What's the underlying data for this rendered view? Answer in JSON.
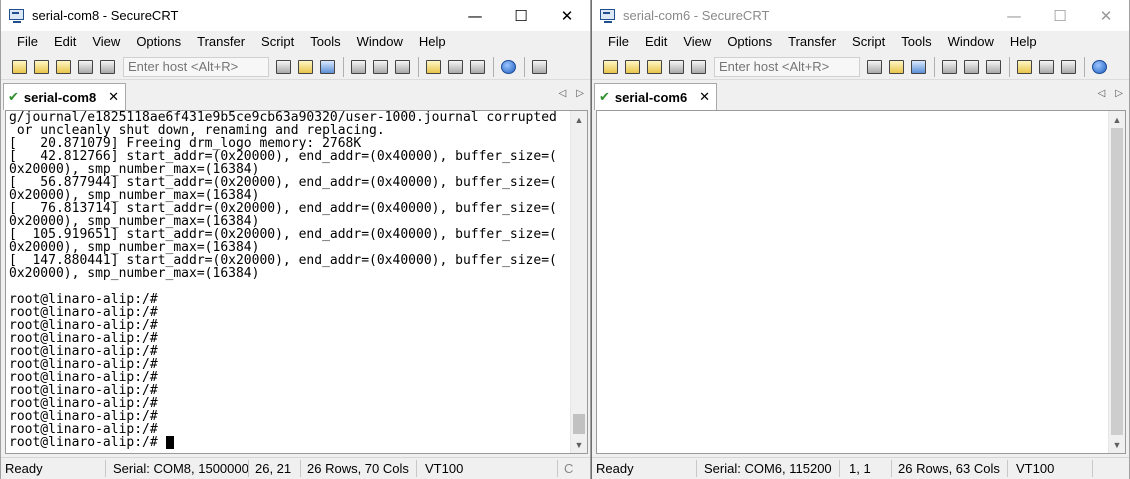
{
  "menu": [
    "File",
    "Edit",
    "View",
    "Options",
    "Transfer",
    "Script",
    "Tools",
    "Window",
    "Help"
  ],
  "host_placeholder": "Enter host <Alt+R>",
  "left": {
    "title": "serial-com8 - SecureCRT",
    "tab": "serial-com8",
    "terminal_lines": [
      "g/journal/e1825118ae6f431e9b5ce9cb63a90320/user-1000.journal corrupted",
      " or uncleanly shut down, renaming and replacing.",
      "[   20.871079] Freeing drm_logo memory: 2768K",
      "[   42.812766] start_addr=(0x20000), end_addr=(0x40000), buffer_size=(",
      "0x20000), smp_number_max=(16384)",
      "[   56.877944] start_addr=(0x20000), end_addr=(0x40000), buffer_size=(",
      "0x20000), smp_number_max=(16384)",
      "[   76.813714] start_addr=(0x20000), end_addr=(0x40000), buffer_size=(",
      "0x20000), smp_number_max=(16384)",
      "[  105.919651] start_addr=(0x20000), end_addr=(0x40000), buffer_size=(",
      "0x20000), smp_number_max=(16384)",
      "[  147.880441] start_addr=(0x20000), end_addr=(0x40000), buffer_size=(",
      "0x20000), smp_number_max=(16384)",
      "",
      "root@linaro-alip:/#",
      "root@linaro-alip:/#",
      "root@linaro-alip:/#",
      "root@linaro-alip:/#",
      "root@linaro-alip:/#",
      "root@linaro-alip:/#",
      "root@linaro-alip:/#",
      "root@linaro-alip:/#",
      "root@linaro-alip:/#",
      "root@linaro-alip:/#",
      "root@linaro-alip:/#",
      "root@linaro-alip:/# "
    ],
    "status": {
      "state": "Ready",
      "connection": "Serial: COM8, 1500000",
      "cursor": "26,  21",
      "size": "26 Rows, 70 Cols",
      "emulation": "VT100",
      "extra": "C"
    }
  },
  "right": {
    "title": "serial-com6 - SecureCRT",
    "tab": "serial-com6",
    "status": {
      "state": "Ready",
      "connection": "Serial: COM6, 115200",
      "cursor": "1,   1",
      "size": "26 Rows, 63 Cols",
      "emulation": "VT100"
    }
  }
}
